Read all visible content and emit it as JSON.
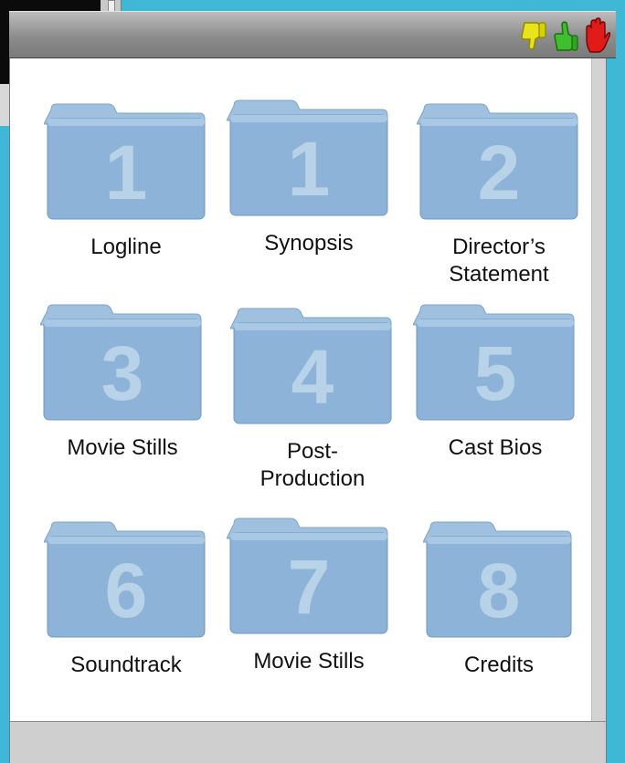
{
  "window": {
    "title_icons": [
      "thumbs-down-icon",
      "thumbs-up-icon",
      "stop-hand-icon"
    ]
  },
  "colors": {
    "folder_body": "#8db4d8",
    "folder_body_dark": "#6e9cc5",
    "folder_tab": "#9fc1df",
    "folder_number": "#c7dcee"
  },
  "folders": [
    {
      "number": "1",
      "label": "Logline"
    },
    {
      "number": "1",
      "label": "Synopsis"
    },
    {
      "number": "2",
      "label": "Director’s Statement"
    },
    {
      "number": "3",
      "label": "Movie Stills"
    },
    {
      "number": "4",
      "label": "Post-Production"
    },
    {
      "number": "5",
      "label": "Cast Bios"
    },
    {
      "number": "6",
      "label": "Soundtrack"
    },
    {
      "number": "7",
      "label": "Movie Stills"
    },
    {
      "number": "8",
      "label": "Credits"
    }
  ]
}
